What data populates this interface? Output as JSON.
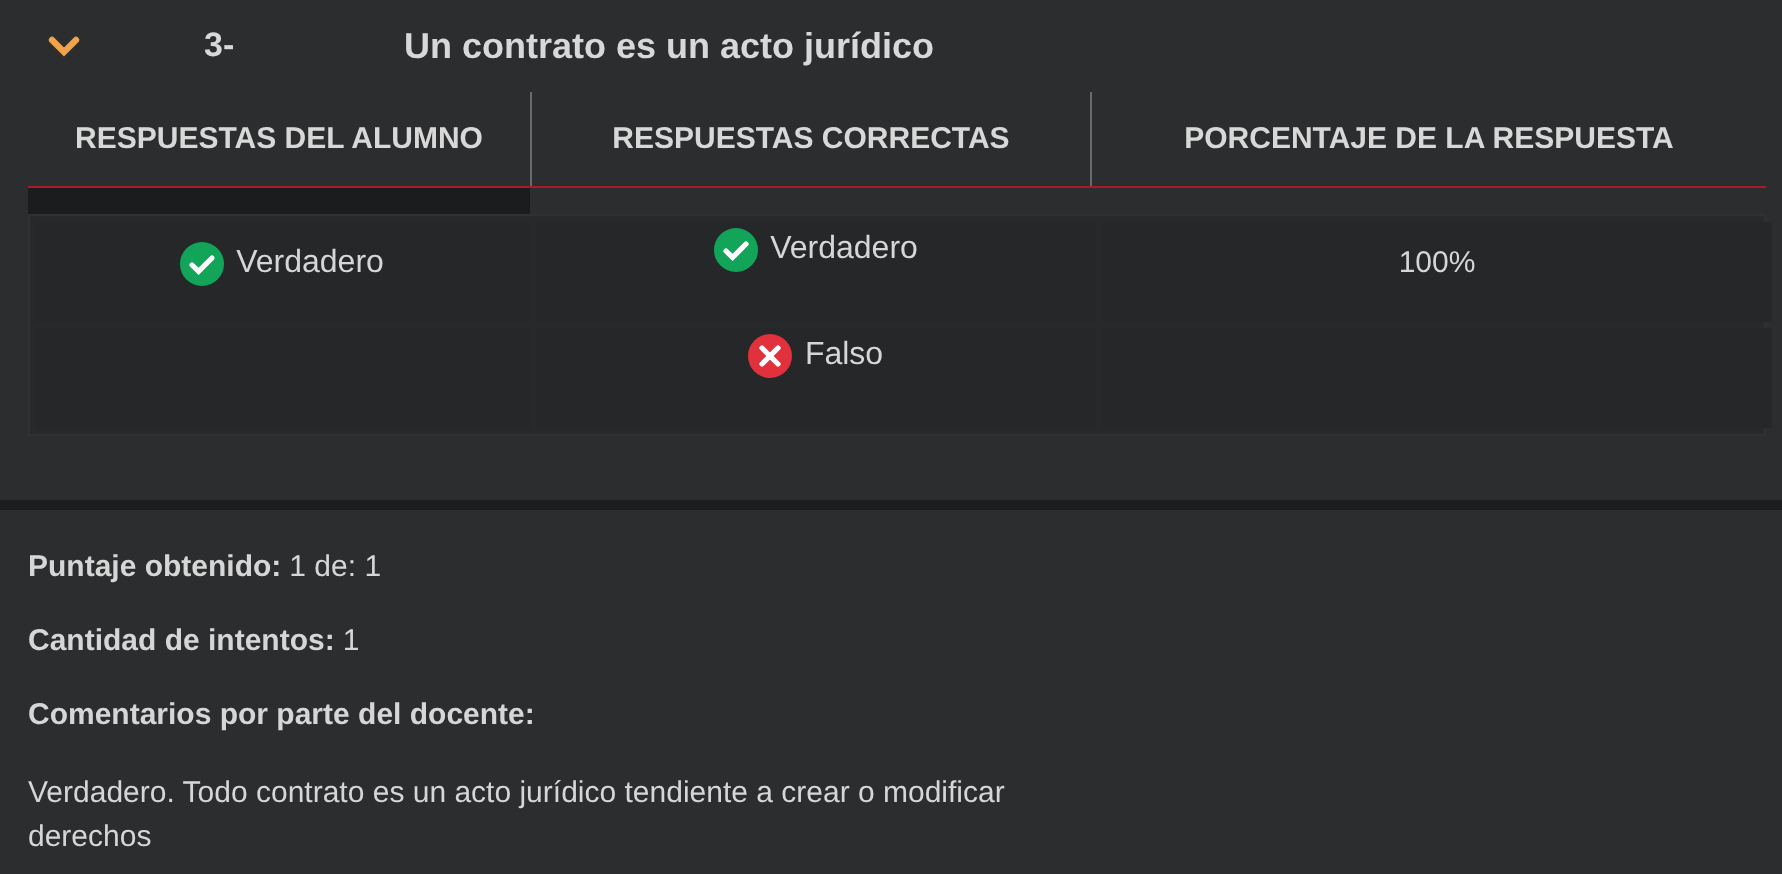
{
  "question": {
    "expanded": true,
    "number": "3-",
    "title": "Un contrato es un acto jurídico"
  },
  "table": {
    "columns": [
      "RESPUESTAS DEL ALUMNO",
      "RESPUESTAS CORRECTAS",
      "PORCENTAJE DE LA RESPUESTA"
    ],
    "rows": [
      {
        "student_answer": {
          "text": "Verdadero",
          "correct": true
        },
        "correct_answer": {
          "text": "Verdadero",
          "correct": true
        },
        "percentage": "100%"
      },
      {
        "correct_answer": {
          "text": "Falso",
          "correct": false
        }
      }
    ]
  },
  "summary": [
    {
      "label": "Puntaje obtenido:",
      "value": "1 de: 1"
    },
    {
      "label": "Cantidad de intentos:",
      "value": "1"
    }
  ],
  "comments": {
    "label": "Comentarios por parte del docente:",
    "text": "Verdadero. Todo contrato es un acto jurídico tendiente a crear o modificar derechos"
  }
}
